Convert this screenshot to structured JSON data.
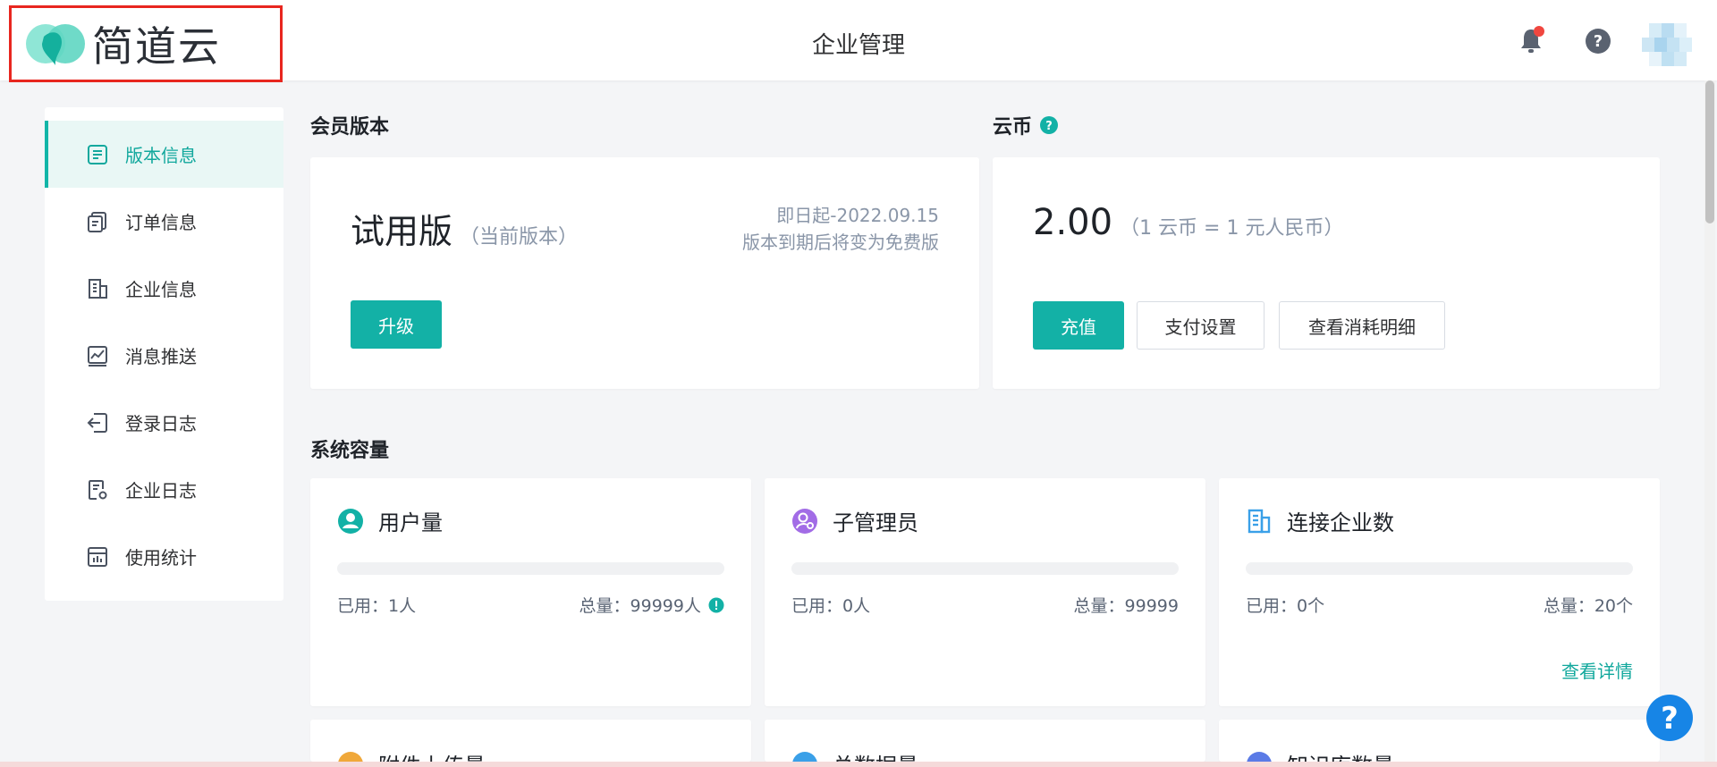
{
  "header": {
    "logo_text": "简道云",
    "title": "企业管理",
    "accent": "#13b1a6",
    "notification_color": "#f0463f"
  },
  "sidebar": {
    "items": [
      {
        "label": "版本信息",
        "icon": "document-icon",
        "active": true
      },
      {
        "label": "订单信息",
        "icon": "order-icon",
        "active": false
      },
      {
        "label": "企业信息",
        "icon": "building-icon",
        "active": false
      },
      {
        "label": "消息推送",
        "icon": "chart-icon",
        "active": false
      },
      {
        "label": "登录日志",
        "icon": "login-icon",
        "active": false
      },
      {
        "label": "企业日志",
        "icon": "log-settings-icon",
        "active": false
      },
      {
        "label": "使用统计",
        "icon": "calculator-icon",
        "active": false
      }
    ]
  },
  "membership": {
    "section_title": "会员版本",
    "version_name": "试用版",
    "version_sub": "（当前版本）",
    "date_line": "即日起-2022.09.15",
    "expire_note": "版本到期后将变为免费版",
    "upgrade_label": "升级"
  },
  "coins": {
    "section_title": "云币",
    "value": "2.00",
    "rate_note": "（1 云币 = 1 元人民币）",
    "recharge_label": "充值",
    "pay_settings_label": "支付设置",
    "view_details_label": "查看消耗明细"
  },
  "capacity": {
    "section_title": "系统容量",
    "cards": [
      {
        "title": "用户量",
        "used": "已用：1人",
        "total": "总量：99999人",
        "fill": 0.0,
        "icon": "user-icon",
        "icon_color": "#13b1a6",
        "has_info": true,
        "link": ""
      },
      {
        "title": "子管理员",
        "used": "已用：0人",
        "total": "总量：99999",
        "fill": 0.0,
        "icon": "admin-icon",
        "icon_color": "#a26ce6",
        "has_info": false,
        "link": ""
      },
      {
        "title": "连接企业数",
        "used": "已用：0个",
        "total": "总量：20个",
        "fill": 0.0,
        "icon": "company-icon",
        "icon_color": "#3aa0e8",
        "has_info": false,
        "link": "查看详情"
      }
    ],
    "partial_cards": [
      {
        "title": "附件上传量",
        "icon_color": "#f0a83a"
      },
      {
        "title": "总数据量",
        "icon_color": "#3aa0e8"
      },
      {
        "title": "知识库数量",
        "icon_color": "#5b7be6"
      }
    ]
  }
}
